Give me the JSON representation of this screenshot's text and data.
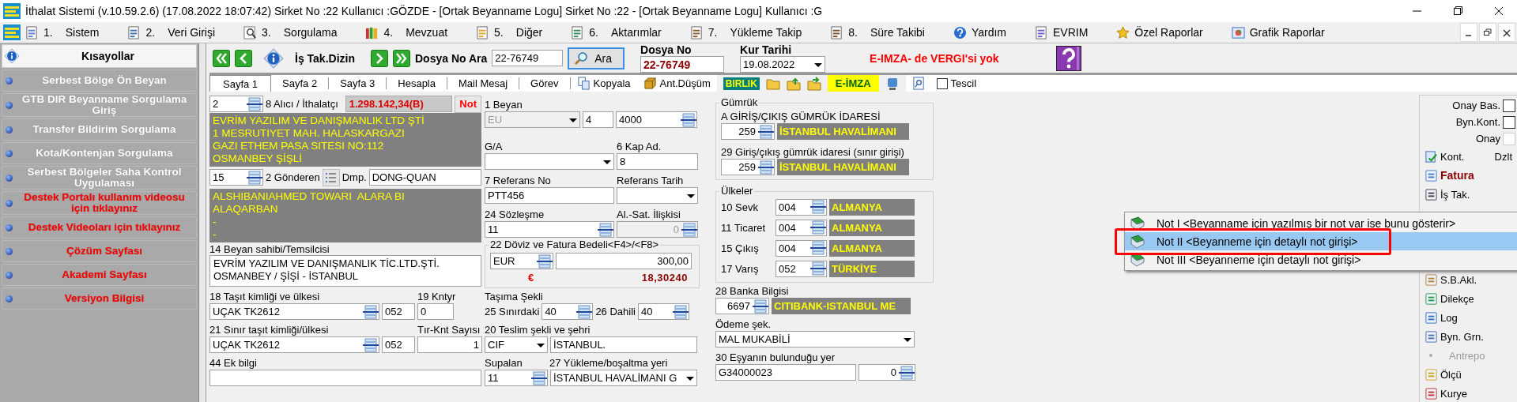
{
  "window": {
    "title": "İthalat Sistemi (v.10.59.2.6) (17.08.2022 18:07:42) Sirket No :22 Kullanıcı :GÖZDE - [Ortak Beyanname Logu] Sirket No :22 - [Ortak Beyanname Logu] Kullanıcı :G"
  },
  "menu": [
    {
      "number": "1.",
      "label": "Sistem"
    },
    {
      "number": "2.",
      "label": "Veri Girişi"
    },
    {
      "number": "3.",
      "label": "Sorgulama"
    },
    {
      "number": "4.",
      "label": "Mevzuat"
    },
    {
      "number": "5.",
      "label": "Diğer"
    },
    {
      "number": "6.",
      "label": "Aktarımlar"
    },
    {
      "number": "7.",
      "label": "Yükleme Takip"
    },
    {
      "number": "8.",
      "label": "Süre Takibi"
    },
    {
      "label": "Yardım"
    },
    {
      "label": "EVRIM"
    },
    {
      "label": "Özel Raporlar"
    },
    {
      "label": "Grafik Raporlar"
    }
  ],
  "sidebar": {
    "title": "Kısayollar",
    "items": [
      {
        "label": "Serbest Bölge Ön Beyan",
        "color": "#ffffff"
      },
      {
        "label": "GTB DIR Beyanname Sorgulama Giriş",
        "color": "#ffffff"
      },
      {
        "label": "Transfer Bildirim Sorgulama",
        "color": "#ffffff"
      },
      {
        "label": "Kota/Kontenjan Sorgulama",
        "color": "#ffffff"
      },
      {
        "label": "Serbest Bölgeler Saha Kontrol Uygulaması",
        "color": "#ffffff"
      },
      {
        "label": "Destek Portalı kullanım videosu için tıklayınız",
        "color": "#ff0000"
      },
      {
        "label": "Destek Videoları için tıklayınız",
        "color": "#ff0000"
      },
      {
        "label": "Çözüm Sayfası",
        "color": "#ff0000"
      },
      {
        "label": "Akademi Sayfası",
        "color": "#ff0000"
      },
      {
        "label": "Versiyon Bilgisi",
        "color": "#ff0000"
      }
    ]
  },
  "toolbar": {
    "dizin_label": "İş Tak.Dizin",
    "search_label": "Dosya No Ara",
    "search_value": "22-76749",
    "search_button": "Ara",
    "dosya_label": "Dosya No",
    "dosya_value": "22-76749",
    "kur_label": "Kur Tarihi",
    "kur_value": "19.08.2022",
    "warning": "E-IMZA- de VERGI'si yok"
  },
  "tabs": [
    {
      "label": "Sayfa 1",
      "selected": true
    },
    {
      "label": "Sayfa 2",
      "selected": false
    },
    {
      "label": "Sayfa 3",
      "selected": false
    },
    {
      "label": "Hesapla",
      "selected": false
    },
    {
      "label": "Mail Mesaj",
      "selected": false
    },
    {
      "label": "Görev",
      "selected": false
    }
  ],
  "tab_tools": {
    "kopyala": "Kopyala",
    "ant_dusum": "Ant.Düşüm",
    "birlik": "BIRLIK",
    "eimza": "E-İMZA",
    "tescil": {
      "label": "Tescil",
      "checked": false
    }
  },
  "alici": {
    "number": "2",
    "label": "8 Alıcı / İthalatçı",
    "amount": "1.298.142,34(B)",
    "note_button": "Not",
    "lines": [
      "EVRİM YAZILIM VE DANIŞMANLIK LTD ŞTİ",
      "1 MESRUTIYET MAH. HALASKARGAZI",
      "GAZI ETHEM PASA SITESI NO:112",
      "OSMANBEY ŞİŞLİ"
    ]
  },
  "gonderen": {
    "number": "15",
    "label": "2 Gönderen",
    "dmp_label": "Dmp.",
    "dmp_value": "DONG-QUAN",
    "lines": [
      "ALSHIBANIAHMED TOWARI  ALARA BI",
      "ALAQARBAN",
      "-",
      "-"
    ]
  },
  "beyan_sahibi": {
    "label": "14 Beyan sahibi/Temsilcisi",
    "lines": [
      "EVRİM YAZILIM VE DANIŞMANLIK TİC.LTD.ŞTİ.",
      "OSMANBEY / ŞİŞİ - İSTANBUL"
    ]
  },
  "tasit": {
    "label": "18 Taşıt kimliği ve ülkesi",
    "value": "UÇAK TK2612",
    "country": "052",
    "kntyr_label": "19 Kntyr",
    "kntyr": "0"
  },
  "sinir_tasit": {
    "label": "21 Sınır taşıt kimliği/ülkesi",
    "value": "UÇAK TK2612",
    "country": "052",
    "count_label": "Tır-Knt Sayısı",
    "count": "1"
  },
  "ek_bilgi": {
    "label": "44 Ek bilgi"
  },
  "beyan": {
    "label": "1 Beyan",
    "type": "EU",
    "type_disabled": true,
    "a": "4",
    "b": "4000"
  },
  "ga": {
    "label": "G/A",
    "kap_label": "6 Kap Ad.",
    "kap": "8"
  },
  "referans": {
    "label": "7 Referans No",
    "value": "PTT456",
    "date_label": "Referans Tarih"
  },
  "sozlesme": {
    "label": "24 Sözleşme",
    "value": "11",
    "iliski_label": "Al.-Sat. İlişkisi",
    "iliski": "0",
    "iliski_disabled": true
  },
  "doviz": {
    "label": "22 Döviz ve Fatura Bedeli<F4>/<F8>",
    "currency": "EUR",
    "amount": "300,00",
    "symbol": "€",
    "rate": "18,30240"
  },
  "tasima": {
    "label": "Taşıma Şekli",
    "sinir_label": "25 Sınırdaki",
    "sinir": "40",
    "dahili_label": "26 Dahili",
    "dahili": "40"
  },
  "teslim": {
    "label": "20 Teslim şekli ve şehri",
    "type": "CIF",
    "city": "İSTANBUL."
  },
  "supalan": {
    "label": "Supalan",
    "value": "11",
    "yer_label": "27 Yükleme/boşaltma yeri",
    "yer": "İSTANBUL HAVALİMANI G"
  },
  "gumruk": {
    "title": "Gümrük",
    "rows": [
      {
        "label": "A GİRİŞ/ÇIKIŞ GÜMRÜK İDARESİ",
        "code": "259",
        "name": "İSTANBUL HAVALİMANI"
      },
      {
        "label": "29 Giriş/çıkış gümrük idaresi (sınır girişi)",
        "code": "259",
        "name": "İSTANBUL HAVALİMANI"
      }
    ]
  },
  "ulkeler": {
    "title": "Ülkeler",
    "rows": [
      {
        "label": "10 Sevk",
        "code": "004",
        "name": "ALMANYA"
      },
      {
        "label": "11 Ticaret",
        "code": "004",
        "name": "ALMANYA"
      },
      {
        "label": "15 Çıkış",
        "code": "004",
        "name": "ALMANYA"
      },
      {
        "label": "17 Varış",
        "code": "052",
        "name": "TÜRKİYE"
      }
    ]
  },
  "banka": {
    "label": "28 Banka Bilgisi",
    "code": "6697",
    "name": "CITIBANK-ISTANBUL ME"
  },
  "odeme": {
    "label": "Ödeme şek.",
    "value": "MAL MUKABİLİ"
  },
  "esya_yeri": {
    "label": "30 Eşyanın bulunduğu yer",
    "value": "G34000023",
    "count": "0"
  },
  "side_panel": {
    "checks": [
      {
        "label": "Onay Bas.",
        "checked": false,
        "disabled": false
      },
      {
        "label": "Byn.Kont.",
        "checked": false,
        "disabled": false
      },
      {
        "label": "Onay",
        "checked": false,
        "disabled": true
      }
    ],
    "kont": "Kont.",
    "dzlt": "Dzlt",
    "actions": [
      {
        "label": "Fatura",
        "kind": "emphasis"
      },
      {
        "label": "İş Tak.",
        "kind": "normal"
      },
      {
        "label": "S.B.Akl.",
        "kind": "normal"
      },
      {
        "label": "Dilekçe",
        "kind": "normal"
      },
      {
        "label": "Log",
        "kind": "normal"
      },
      {
        "label": "Byn. Grn.",
        "kind": "normal"
      },
      {
        "label": "Antrepo",
        "kind": "disabled"
      },
      {
        "label": "Ölçü",
        "kind": "normal"
      },
      {
        "label": "Kurye",
        "kind": "normal"
      }
    ]
  },
  "context_menu": [
    {
      "label": "Not I <Beyanname için yazılmış bir not var ise bunu gösterir>",
      "selected": false
    },
    {
      "label": "Not II <Beyanneme için detaylı not girişi>",
      "selected": true
    },
    {
      "label": "Not III <Beyanneme için detaylı not girişi>",
      "selected": false
    }
  ]
}
